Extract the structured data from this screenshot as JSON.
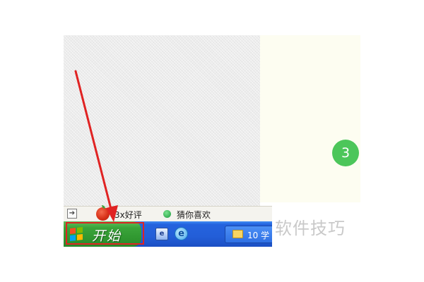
{
  "side_panel": {
    "step_number": "3"
  },
  "quick_bar": {
    "item1_label": "3x好评",
    "item2_label": "猜你喜欢",
    "icons": [
      "arrow-out-icon",
      "apple-icon",
      "green-dot-icon"
    ]
  },
  "taskbar": {
    "start_label": "开始",
    "quick_launch_icons": [
      "desktop-icon",
      "ie-icon"
    ],
    "task_item_label": "10 学",
    "colors": {
      "taskbar": "#235ed8",
      "start_button": "#3aa43a"
    }
  },
  "start_logo": {
    "colors": [
      "#f25022",
      "#7fba00",
      "#00a4ef",
      "#ffb900"
    ]
  },
  "annotations": {
    "highlight_color": "#e02323",
    "arrow_color": "#e02323"
  },
  "watermark": "软件技巧"
}
